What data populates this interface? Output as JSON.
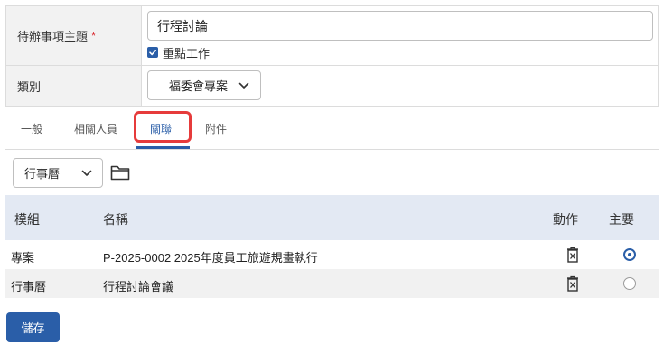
{
  "form": {
    "subject_label": "待辦事項主題",
    "required_mark": "*",
    "subject_value": "行程討論",
    "important_label": "重點工作",
    "important_checked": true,
    "category_label": "類別",
    "category_value": "福委會專案"
  },
  "tabs": [
    {
      "label": "一般",
      "active": false
    },
    {
      "label": "相關人員",
      "active": false
    },
    {
      "label": "關聯",
      "active": true
    },
    {
      "label": "附件",
      "active": false
    }
  ],
  "toolbar": {
    "module_value": "行事曆",
    "folder_icon": "folder-icon"
  },
  "grid": {
    "headers": {
      "module": "模組",
      "name": "名稱",
      "action": "動作",
      "primary": "主要"
    },
    "rows": [
      {
        "module": "專案",
        "name": "P-2025-0002 2025年度員工旅遊規畫執行",
        "primary": true
      },
      {
        "module": "行事曆",
        "name": "行程討論會議",
        "primary": false
      }
    ]
  },
  "footer": {
    "save_label": "儲存"
  },
  "colors": {
    "accent": "#2a5ea8",
    "highlight": "#e63b3b",
    "required": "#d9282f"
  }
}
